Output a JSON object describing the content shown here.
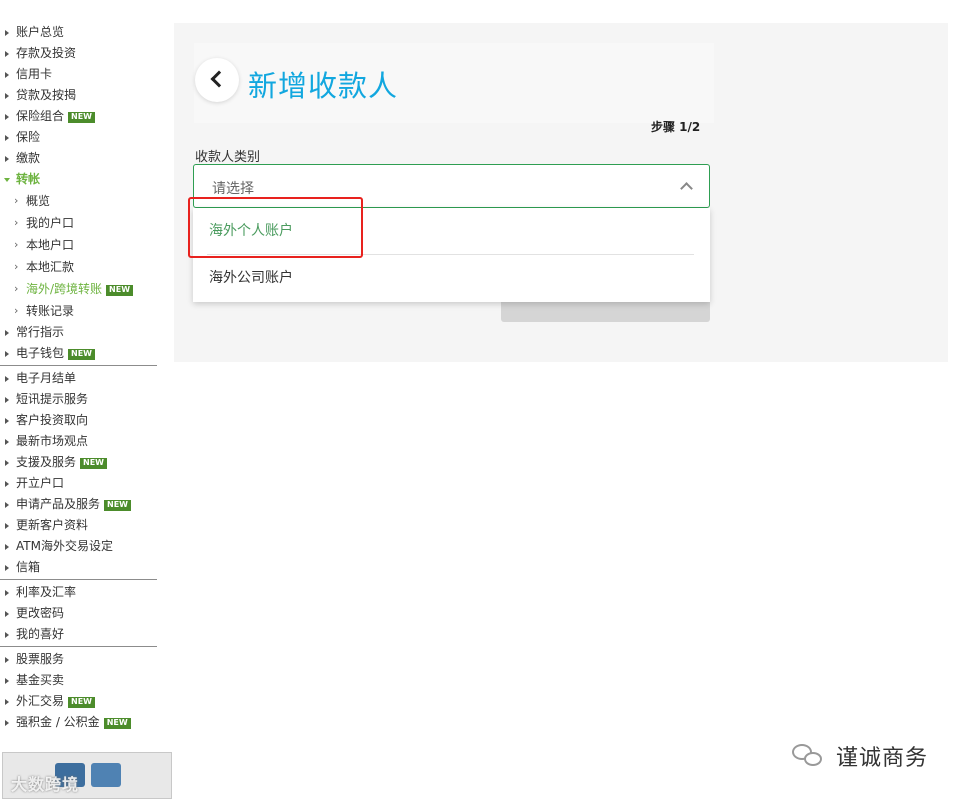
{
  "sidebar": {
    "group1": [
      {
        "label": "账户总览"
      },
      {
        "label": "存款及投资"
      },
      {
        "label": "信用卡"
      },
      {
        "label": "贷款及按揭"
      },
      {
        "label": "保险组合",
        "badge": "NEW"
      },
      {
        "label": "保险"
      },
      {
        "label": "缴款"
      },
      {
        "label": "转帐",
        "active": true
      }
    ],
    "transfer_sub": [
      {
        "label": "概览"
      },
      {
        "label": "我的户口"
      },
      {
        "label": "本地户口"
      },
      {
        "label": "本地汇款"
      },
      {
        "label": "海外/跨境转账",
        "badge": "NEW",
        "active": true
      },
      {
        "label": "转账记录"
      }
    ],
    "group1b": [
      {
        "label": "常行指示"
      },
      {
        "label": "电子钱包",
        "badge": "NEW"
      }
    ],
    "group2": [
      {
        "label": "电子月结单"
      },
      {
        "label": "短讯提示服务"
      },
      {
        "label": "客户投资取向"
      },
      {
        "label": "最新市场观点"
      },
      {
        "label": "支援及服务",
        "badge": "NEW"
      },
      {
        "label": "开立户口"
      },
      {
        "label": "申请产品及服务",
        "badge": "NEW"
      },
      {
        "label": "更新客户资料"
      },
      {
        "label": "ATM海外交易设定"
      },
      {
        "label": "信箱"
      }
    ],
    "group3": [
      {
        "label": "利率及汇率"
      },
      {
        "label": "更改密码"
      },
      {
        "label": "我的喜好"
      }
    ],
    "group4": [
      {
        "label": "股票服务"
      },
      {
        "label": "基金买卖"
      },
      {
        "label": "外汇交易",
        "badge": "NEW"
      },
      {
        "label": "强积金 / 公积金",
        "badge": "NEW"
      }
    ],
    "bottom_watermark": "大数跨境"
  },
  "main": {
    "title": "新增收款人",
    "step": "步骤 1/2",
    "field_label": "收款人类别",
    "select_placeholder": "请选择",
    "options": [
      "海外个人账户",
      "海外公司账户"
    ]
  },
  "footer": {
    "wechat_name": "谨诚商务"
  },
  "colors": {
    "accent_title": "#12a7df",
    "active_green": "#6db33f",
    "badge_green": "#4c8c2b",
    "highlight_red": "#e8221e",
    "select_border": "#2e9e52"
  }
}
